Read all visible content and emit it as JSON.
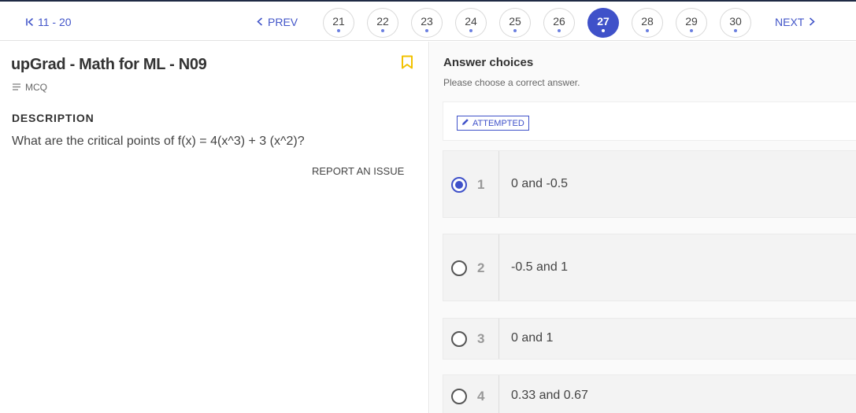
{
  "nav": {
    "range_label": "11 - 20",
    "prev_label": "PREV",
    "next_label": "NEXT",
    "pages": [
      {
        "label": "21",
        "active": false
      },
      {
        "label": "22",
        "active": false
      },
      {
        "label": "23",
        "active": false
      },
      {
        "label": "24",
        "active": false
      },
      {
        "label": "25",
        "active": false
      },
      {
        "label": "26",
        "active": false
      },
      {
        "label": "27",
        "active": true
      },
      {
        "label": "28",
        "active": false
      },
      {
        "label": "29",
        "active": false
      },
      {
        "label": "30",
        "active": false
      }
    ]
  },
  "question": {
    "title": "upGrad - Math for ML - N09",
    "type_label": "MCQ",
    "description_heading": "DESCRIPTION",
    "text": "What are the critical points of f(x) = 4(x^3) + 3 (x^2)?",
    "report_label": "REPORT AN ISSUE"
  },
  "answers": {
    "heading": "Answer choices",
    "subheading": "Please choose a correct answer.",
    "status_label": "ATTEMPTED",
    "options": [
      {
        "index": "1",
        "text": "0 and -0.5",
        "selected": true
      },
      {
        "index": "2",
        "text": "-0.5 and 1",
        "selected": false
      },
      {
        "index": "3",
        "text": "0 and 1",
        "selected": false
      },
      {
        "index": "4",
        "text": "0.33 and 0.67",
        "selected": false
      }
    ]
  },
  "icons": {
    "first": "first-page-icon",
    "prev": "chevron-left-icon",
    "next": "chevron-right-icon",
    "bookmark": "bookmark-icon",
    "type": "list-icon",
    "status": "pencil-icon"
  },
  "colors": {
    "accent": "#3f51c9",
    "bookmark": "#f2c200"
  }
}
